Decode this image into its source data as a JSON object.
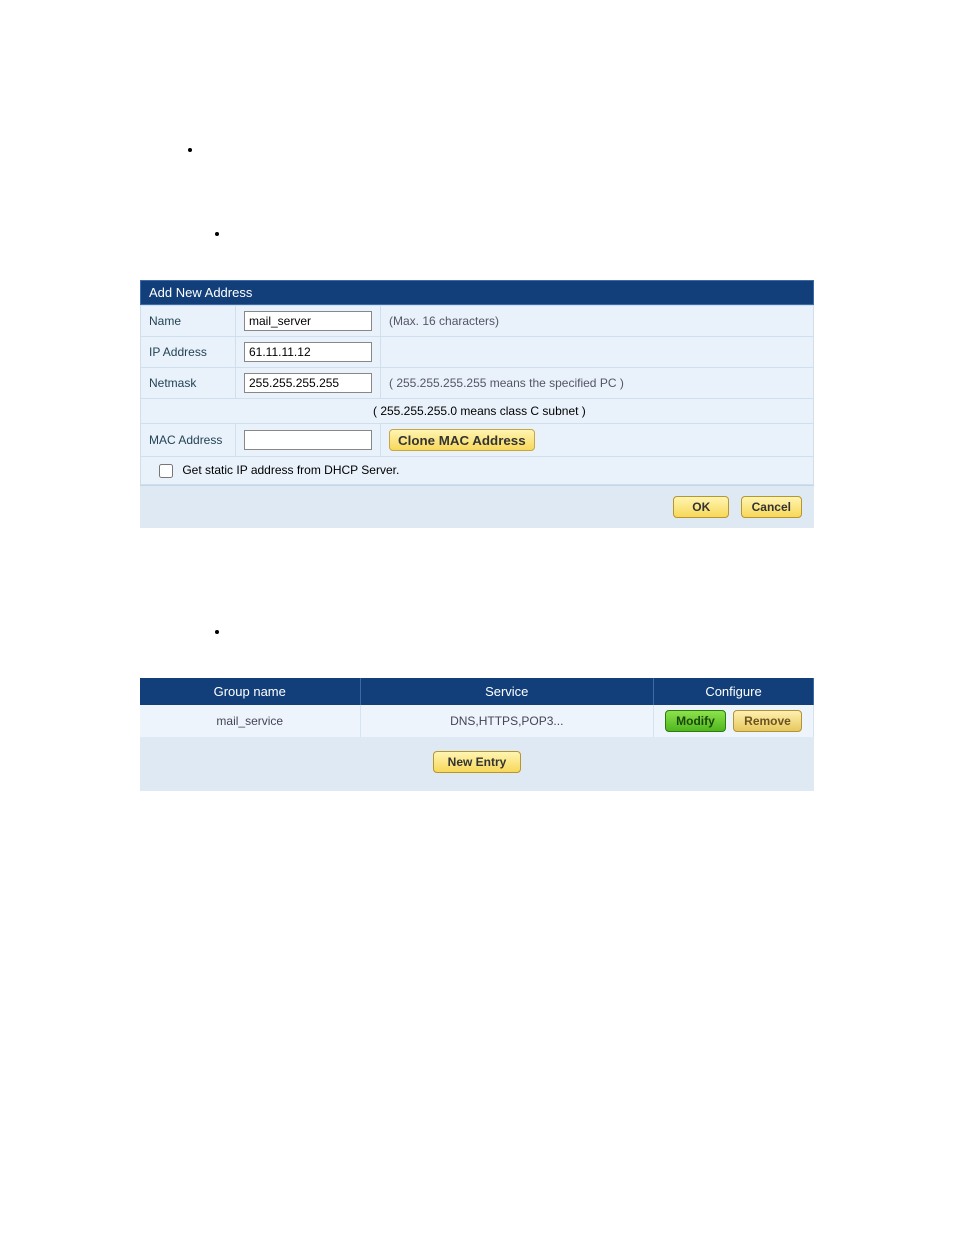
{
  "form": {
    "title": "Add New Address",
    "name_label": "Name",
    "name_value": "mail_server",
    "name_hint": "(Max. 16 characters)",
    "ip_label": "IP Address",
    "ip_value": "61.11.11.12",
    "netmask_label": "Netmask",
    "netmask_value": "255.255.255.255",
    "netmask_hint": "( 255.255.255.255 means the specified PC )",
    "netmask_hint2": "( 255.255.255.0 means class C subnet )",
    "mac_label": "MAC Address",
    "mac_value": "",
    "clone_btn": "Clone MAC Address",
    "dhcp_label": "Get static IP address from DHCP Server.",
    "ok_btn": "OK",
    "cancel_btn": "Cancel"
  },
  "table": {
    "headers": {
      "group": "Group name",
      "service": "Service",
      "configure": "Configure"
    },
    "row": {
      "group": "mail_service",
      "service": "DNS,HTTPS,POP3..."
    },
    "modify_btn": "Modify",
    "remove_btn": "Remove",
    "new_entry_btn": "New  Entry"
  }
}
